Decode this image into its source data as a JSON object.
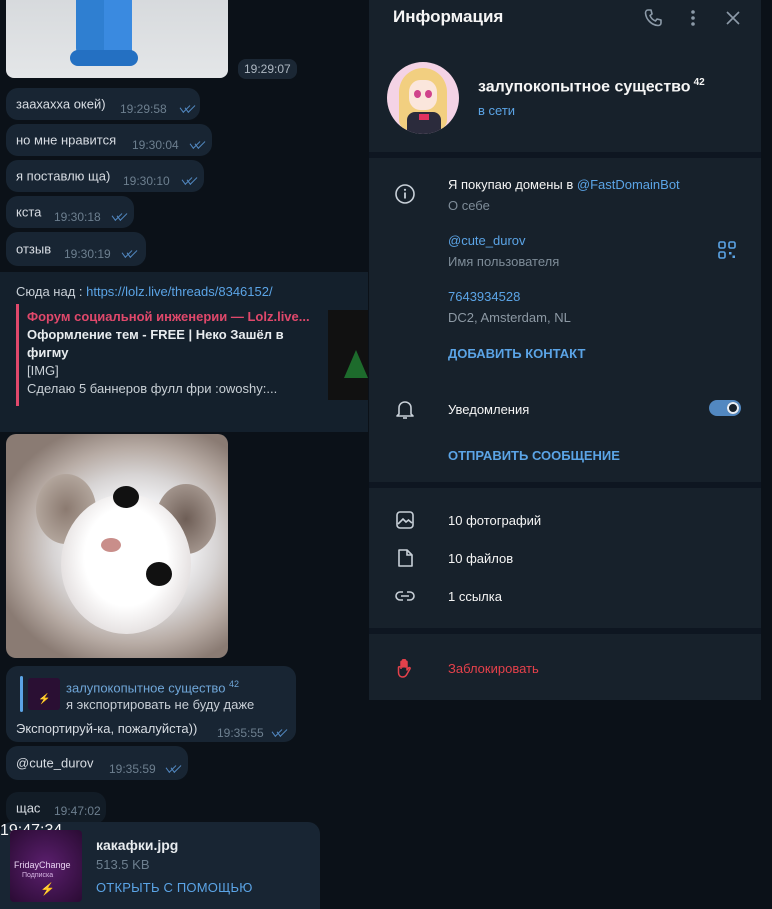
{
  "chat": {
    "top_image_time": "19:29:07",
    "messages": [
      {
        "text": "заахахха окей)",
        "time": "19:29:58"
      },
      {
        "text": "но мне нравится",
        "time": "19:30:04"
      },
      {
        "text": "я поставлю ща)",
        "time": "19:30:10"
      },
      {
        "text": "кста",
        "time": "19:30:18"
      },
      {
        "text": "отзыв",
        "time": "19:30:19"
      }
    ],
    "link_message": {
      "prefix": "Сюда над : ",
      "url": "https://lolz.live/threads/8346152/",
      "site_name": "Форум социальной инженерии — Lolz.live...",
      "title": "Оформление тем - FREE | Неко Зашёл в фигму",
      "desc_line1": "[IMG]",
      "desc_line2": "Сделаю 5 баннеров фулл фри :owoshy:..."
    },
    "reply_message": {
      "reply_author": "залупокопытное существо",
      "reply_author_sup": "42",
      "reply_text": "я экспортировать не буду даже",
      "text": "Экспортируй-ка, пожалуйста))",
      "time": "19:35:55"
    },
    "mention_message": {
      "text": "@cute_durov",
      "time": "19:35:59"
    },
    "short_message": {
      "text": "щас",
      "time": "19:47:02"
    },
    "file_message": {
      "name": "какафки.jpg",
      "size": "513.5 KB",
      "open_label": "ОТКРЫТЬ С ПОМОЩЬЮ",
      "time": "19:47:34",
      "thumb_line1": "FridayChange",
      "thumb_line2": "Подписка",
      "thumb_line3": "⚡"
    }
  },
  "panel": {
    "title": "Информация",
    "profile_name": "залупокопытное существо",
    "profile_name_sup": "42",
    "profile_status": "в сети",
    "bio_prefix": "Я покупаю домены в ",
    "bio_link": "@FastDomainBot",
    "bio_label": "О себе",
    "username": "@cute_durov",
    "username_label": "Имя пользователя",
    "phone": "7643934528",
    "phone_sub": "DC2, Amsterdam, NL",
    "add_contact": "ДОБАВИТЬ КОНТАКТ",
    "notifications_label": "Уведомления",
    "notifications_on": true,
    "send_message": "ОТПРАВИТЬ СООБЩЕНИЕ",
    "photos": "10 фотографий",
    "files": "10 файлов",
    "links": "1 ссылка",
    "block": "Заблокировать"
  },
  "colors": {
    "accent": "#5ba4e6",
    "danger": "#e5414b",
    "panel_bg": "#17212b",
    "bubble_bg": "#182533"
  }
}
